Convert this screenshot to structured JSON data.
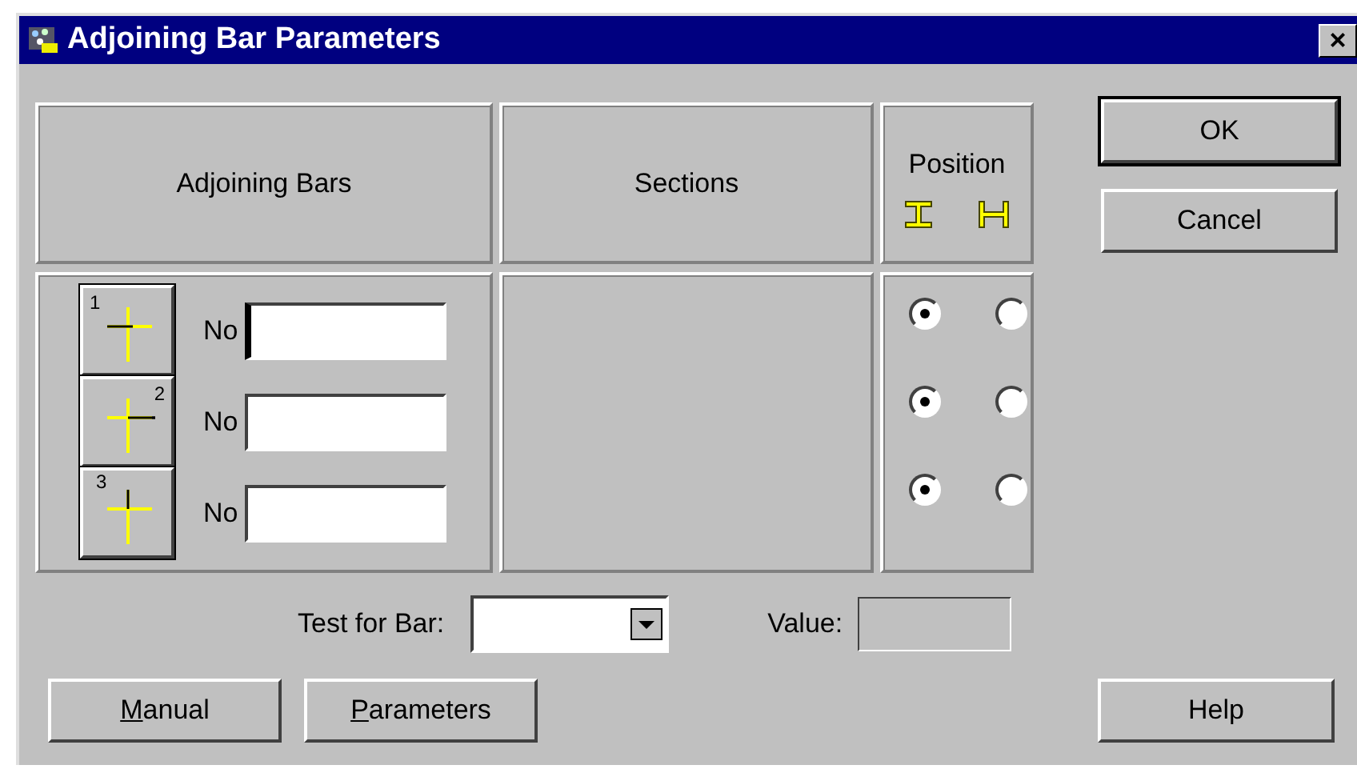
{
  "window": {
    "title": "Adjoining Bar Parameters",
    "close": "×"
  },
  "headers": {
    "adjoining_bars": "Adjoining Bars",
    "sections": "Sections",
    "position": "Position"
  },
  "bars": [
    {
      "kind": "left",
      "number": "1",
      "label": "No",
      "focused": true,
      "options": [
        {
          "selected": true
        },
        {
          "selected": false
        }
      ]
    },
    {
      "kind": "right",
      "number": "2",
      "label": "No",
      "focused": false,
      "options": [
        {
          "selected": true
        },
        {
          "selected": false
        }
      ]
    },
    {
      "kind": "top",
      "number": "3",
      "label": "No",
      "focused": false,
      "options": [
        {
          "selected": true
        },
        {
          "selected": false
        }
      ]
    }
  ],
  "test_for_bar": {
    "label": "Test for Bar:"
  },
  "value_field": {
    "label": "Value:",
    "disabled": true
  },
  "side_buttons": [
    {
      "label": "OK",
      "default": true
    },
    {
      "label": "Cancel",
      "default": false
    }
  ],
  "bottom_buttons": [
    {
      "mnemonic": "M",
      "rest": "anual"
    },
    {
      "mnemonic": "P",
      "rest": "arameters"
    }
  ],
  "help_button": {
    "label": "Help"
  }
}
